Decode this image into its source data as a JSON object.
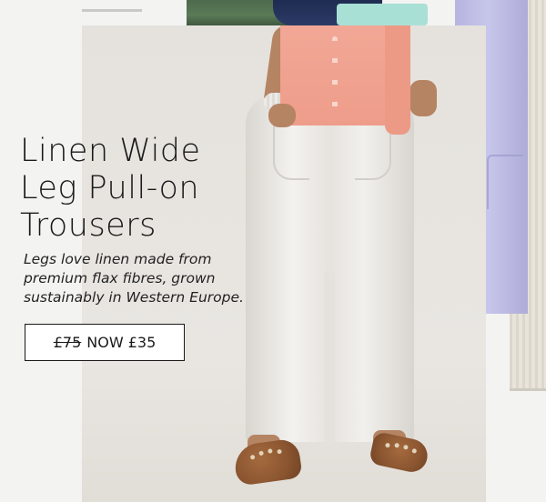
{
  "product": {
    "title_lines": [
      "Linen Wide",
      "Leg Pull-on",
      "Trousers"
    ],
    "description_lines": [
      "Legs love linen made from",
      "premium flax fibres, grown",
      "sustainably in Western Europe."
    ],
    "price": {
      "was": "£75",
      "now_label": "NOW £35"
    }
  },
  "colors": {
    "text": "#1a1a1a",
    "button_bg": "#ffffff",
    "trousers": "#eeece8",
    "shirt": "#f2a796",
    "lavender": "#b6b4e0",
    "page_bg": "#f3f3f2"
  }
}
